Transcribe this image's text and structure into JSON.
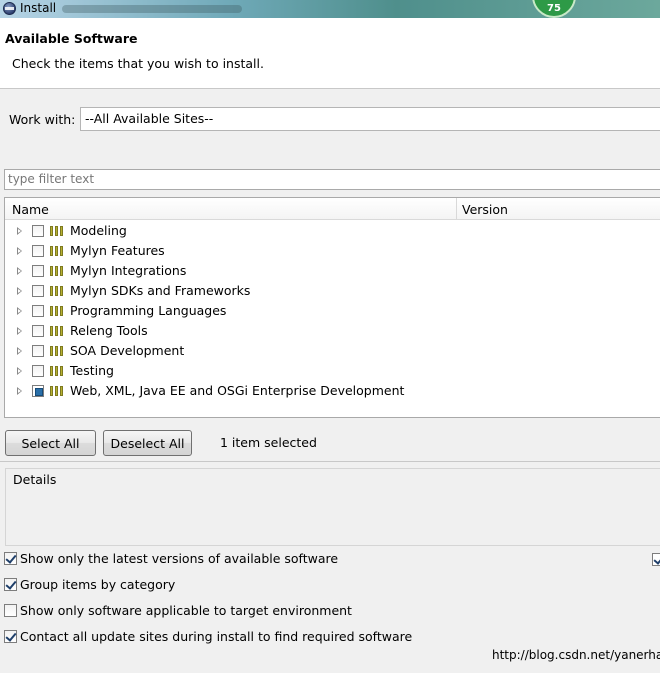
{
  "window": {
    "title": "Install",
    "badge": "75"
  },
  "header": {
    "title": "Available Software",
    "subtitle": "Check the items that you wish to install."
  },
  "work_with": {
    "label": "Work with:",
    "value": "--All Available Sites--"
  },
  "filter": {
    "placeholder": "type filter text"
  },
  "table": {
    "columns": [
      "Name",
      "Version"
    ],
    "rows": [
      {
        "label": "Modeling",
        "state": "unchecked"
      },
      {
        "label": "Mylyn Features",
        "state": "unchecked"
      },
      {
        "label": "Mylyn Integrations",
        "state": "unchecked"
      },
      {
        "label": "Mylyn SDKs and Frameworks",
        "state": "unchecked"
      },
      {
        "label": "Programming Languages",
        "state": "unchecked"
      },
      {
        "label": "Releng Tools",
        "state": "unchecked"
      },
      {
        "label": "SOA Development",
        "state": "unchecked"
      },
      {
        "label": "Testing",
        "state": "unchecked"
      },
      {
        "label": "Web, XML, Java EE and OSGi Enterprise Development",
        "state": "partial"
      }
    ]
  },
  "actions": {
    "select_all": "Select All",
    "deselect_all": "Deselect All",
    "selected_count": "1 item selected"
  },
  "details": {
    "label": "Details"
  },
  "options": [
    {
      "label": "Show only the latest versions of available software",
      "checked": true
    },
    {
      "label": "Group items by category",
      "checked": true
    },
    {
      "label": "Show only software applicable to target environment",
      "checked": false
    },
    {
      "label": "Contact all update sites during install to find required software",
      "checked": true
    }
  ],
  "watermark": "http://blog.csdn.net/yanerhao",
  "colors": {
    "titlebar": "#4f8f8c",
    "badge": "#2e9a47",
    "partial_check": "#2a6fa8",
    "category_icon": "#b6b030"
  }
}
